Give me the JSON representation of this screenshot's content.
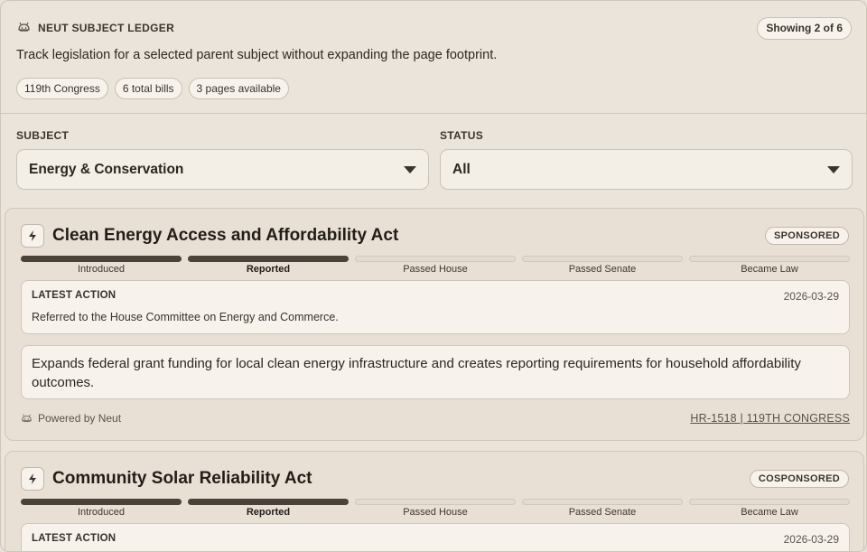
{
  "header": {
    "brand": "NEUT SUBJECT LEDGER",
    "showing": "Showing 2 of 6",
    "description": "Track legislation for a selected parent subject without expanding the page footprint.",
    "chips": [
      "119th Congress",
      "6 total bills",
      "3 pages available"
    ]
  },
  "filters": {
    "subject_label": "SUBJECT",
    "subject_value": "Energy & Conservation",
    "status_label": "STATUS",
    "status_value": "All"
  },
  "colors": {
    "background": "#ebe4da",
    "progress_done": "#4b423a",
    "progress_pending": "#e3dbd0",
    "panel": "#f7f3ec"
  },
  "steps": [
    "Introduced",
    "Reported",
    "Passed House",
    "Passed Senate",
    "Became Law"
  ],
  "bills": [
    {
      "title": "Clean Energy Access and Affordability Act",
      "badge": "SPONSORED",
      "icon": "lightning-icon",
      "current_step": 1,
      "action_label": "LATEST ACTION",
      "action_date": "2026-03-29",
      "action_text": "Referred to the House Committee on Energy and Commerce.",
      "summary": "Expands federal grant funding for local clean energy infrastructure and creates reporting requirements for household affordability outcomes.",
      "powered": "Powered by Neut",
      "reference": "HR-1518 | 119TH CONGRESS"
    },
    {
      "title": "Community Solar Reliability Act",
      "badge": "COSPONSORED",
      "icon": "lightning-icon",
      "current_step": 1,
      "action_label": "LATEST ACTION",
      "action_date": "2026-03-29"
    }
  ]
}
